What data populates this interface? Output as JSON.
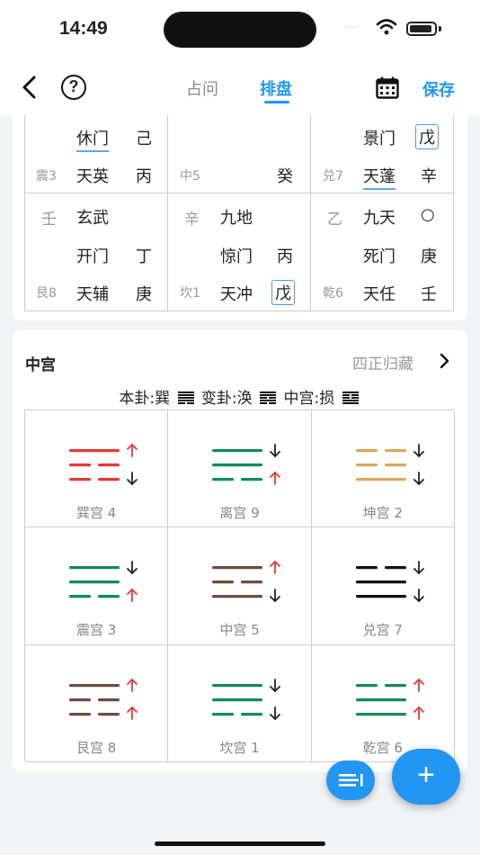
{
  "status_bar": {
    "time": "14:49",
    "signal": "····"
  },
  "nav": {
    "tabs": [
      {
        "label": "占问",
        "active": false
      },
      {
        "label": "排盘",
        "active": true
      }
    ],
    "save_label": "保存",
    "help_label": "?"
  },
  "chart_top": {
    "row1": {
      "left": {
        "door": "休门",
        "stem": "己",
        "gong": "震3",
        "star": "天英",
        "star_stem": "丙"
      },
      "center": {
        "gong": "中5",
        "stem": "癸"
      },
      "right": {
        "door": "景门",
        "door_stem": "戊",
        "gong": "兑7",
        "star": "天蓬",
        "star_stem": "辛"
      }
    },
    "row2": {
      "left": {
        "hidden_stem": "壬",
        "god": "玄武",
        "door": "开门",
        "door_stem": "丁",
        "gong": "艮8",
        "star": "天辅",
        "star_stem": "庚"
      },
      "center": {
        "hidden_stem": "辛",
        "god": "九地",
        "door": "惊门",
        "door_stem": "丙",
        "gong": "坎1",
        "star": "天冲",
        "star_stem": "戊"
      },
      "right": {
        "hidden_stem": "乙",
        "god": "九天",
        "mark": "○",
        "door": "死门",
        "door_stem": "庚",
        "gong": "乾6",
        "star": "天任",
        "star_stem": "壬"
      }
    }
  },
  "zhonggong": {
    "title": "中宫",
    "link_label": "四正归藏",
    "ben_gua": "本卦:巽",
    "bian_gua": "变卦:涣",
    "zhong_gong": "中宫:损",
    "palaces": [
      {
        "name": "巽宫 4",
        "color": "#e53935",
        "lines": [
          1,
          0,
          0
        ],
        "arrows": [
          "up",
          "down"
        ]
      },
      {
        "name": "离宫 9",
        "color": "#118a5a",
        "lines": [
          1,
          1,
          0
        ],
        "arrows": [
          "down",
          "up"
        ]
      },
      {
        "name": "坤宫 2",
        "color": "#d4a95c",
        "lines": [
          0,
          0,
          1
        ],
        "arrows": [
          "down",
          "down"
        ]
      },
      {
        "name": "震宫 3",
        "color": "#118a5a",
        "lines": [
          1,
          1,
          0
        ],
        "arrows": [
          "down",
          "up"
        ]
      },
      {
        "name": "中宫 5",
        "color": "#6d4c41",
        "lines": [
          1,
          0,
          1
        ],
        "arrows": [
          "up",
          "down"
        ]
      },
      {
        "name": "兑宫 7",
        "color": "#111111",
        "lines": [
          0,
          1,
          1
        ],
        "arrows": [
          "down",
          "down"
        ]
      },
      {
        "name": "艮宫 8",
        "color": "#6d4c41",
        "lines": [
          1,
          0,
          0
        ],
        "arrows": [
          "up",
          "up"
        ]
      },
      {
        "name": "坎宫 1",
        "color": "#118a5a",
        "lines": [
          1,
          1,
          0
        ],
        "arrows": [
          "down",
          "down"
        ]
      },
      {
        "name": "乾宫 6",
        "color": "#118a5a",
        "lines": [
          0,
          1,
          1
        ],
        "arrows": [
          "up",
          "up"
        ]
      }
    ]
  },
  "colors": {
    "accent": "#2196f3",
    "up_arrow": "#e53935",
    "down_arrow": "#222222"
  },
  "fab": {
    "add_label": "+"
  }
}
